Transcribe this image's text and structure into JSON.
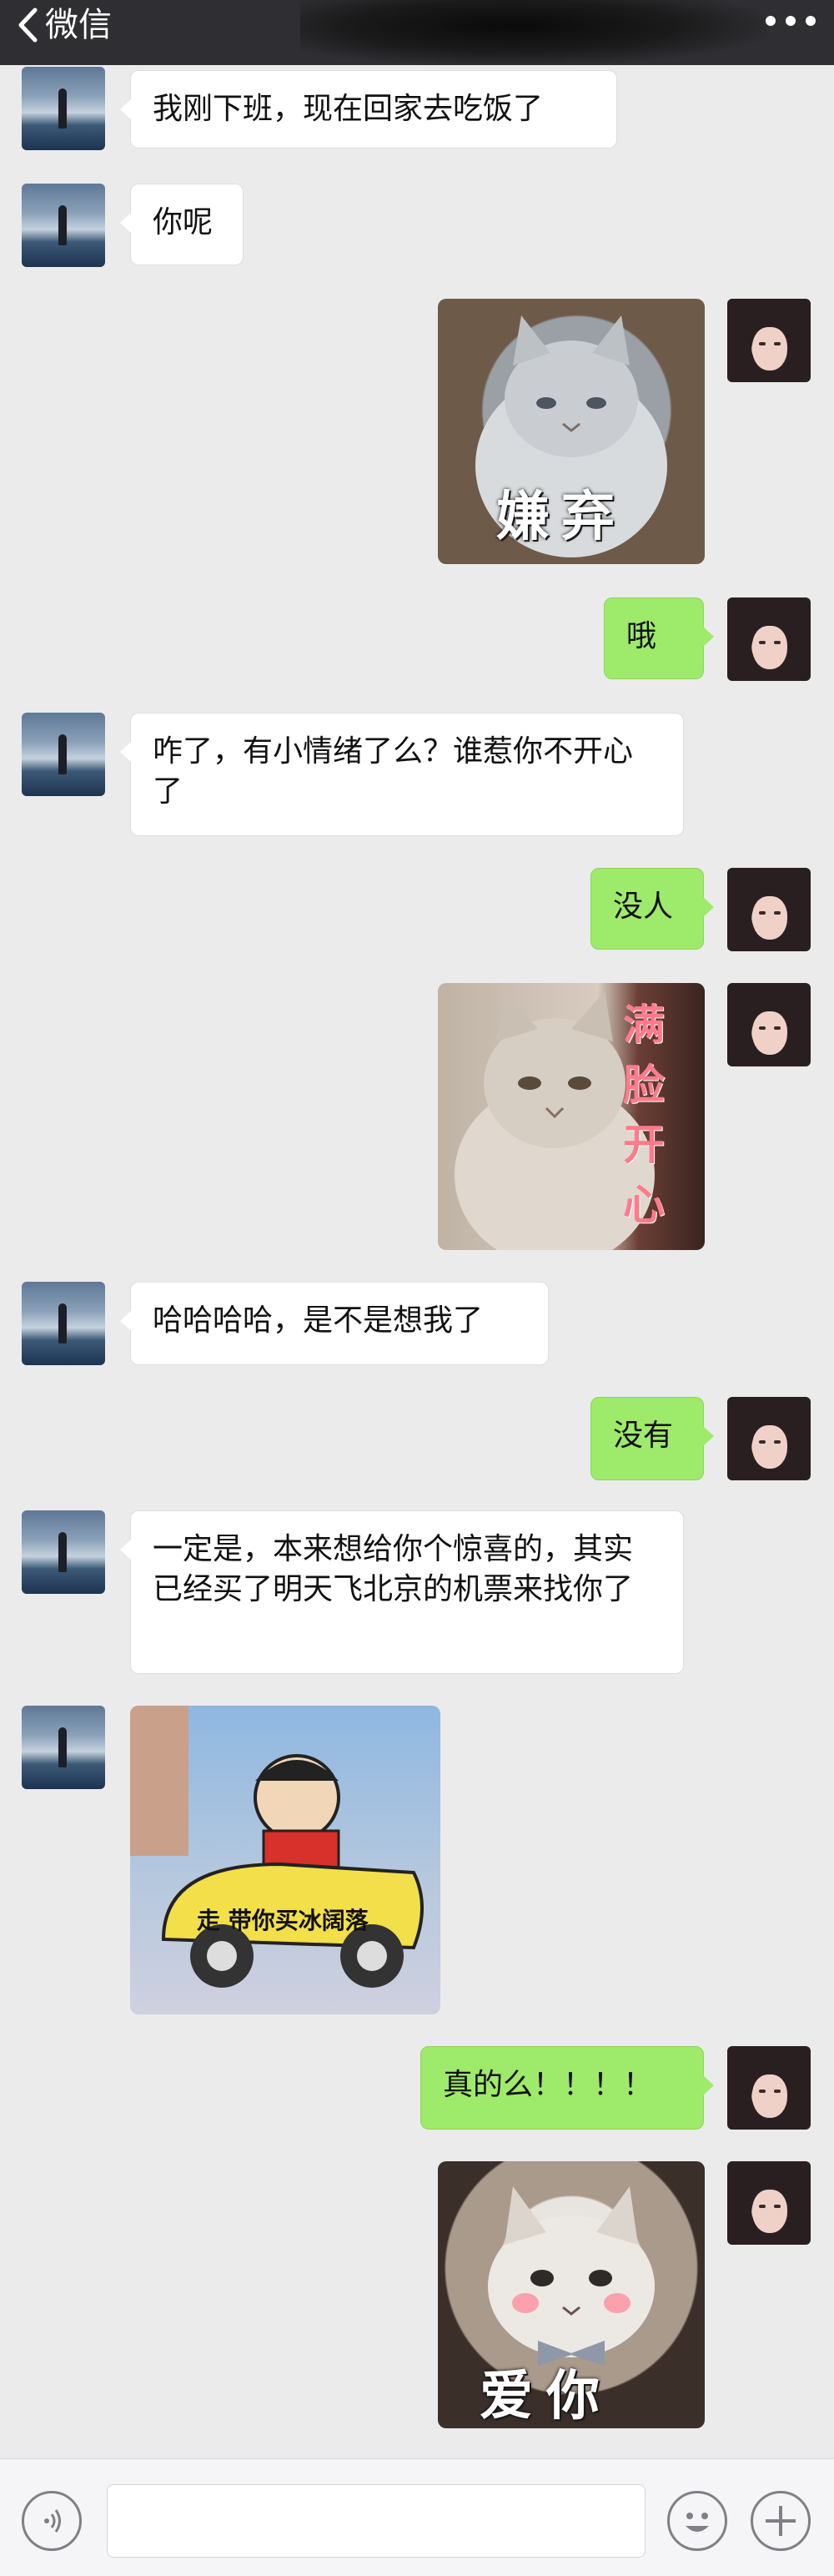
{
  "header": {
    "back_label": "微信",
    "back_icon": "chevron-left-icon",
    "more_icon": "more-dots-icon"
  },
  "messages": [
    {
      "side": "left",
      "type": "text",
      "text": "我刚下班，现在回家去吃饭了"
    },
    {
      "side": "left",
      "type": "text",
      "text": "你呢"
    },
    {
      "side": "right",
      "type": "sticker",
      "caption": "嫌弃"
    },
    {
      "side": "right",
      "type": "text",
      "text": "哦"
    },
    {
      "side": "left",
      "type": "text",
      "text": "咋了，有小情绪了么？谁惹你不开心了"
    },
    {
      "side": "right",
      "type": "text",
      "text": "没人"
    },
    {
      "side": "right",
      "type": "sticker",
      "caption": "满脸开心"
    },
    {
      "side": "left",
      "type": "text",
      "text": "哈哈哈哈，是不是想我了"
    },
    {
      "side": "right",
      "type": "text",
      "text": "没有"
    },
    {
      "side": "left",
      "type": "text",
      "text": "一定是，本来想给你个惊喜的，其实已经买了明天飞北京的机票来找你了"
    },
    {
      "side": "left",
      "type": "sticker",
      "caption": "走 带你买冰阔落"
    },
    {
      "side": "right",
      "type": "text",
      "text": "真的么！！！！"
    },
    {
      "side": "right",
      "type": "sticker",
      "caption": "爱你"
    }
  ],
  "input_bar": {
    "voice_icon": "voice-icon",
    "input_value": "",
    "emoji_icon": "emoji-icon",
    "plus_icon": "plus-icon"
  },
  "colors": {
    "header_bg": "#2f2f33",
    "chat_bg": "#ebebeb",
    "bubble_self": "#9eea6a",
    "bubble_other": "#ffffff"
  }
}
